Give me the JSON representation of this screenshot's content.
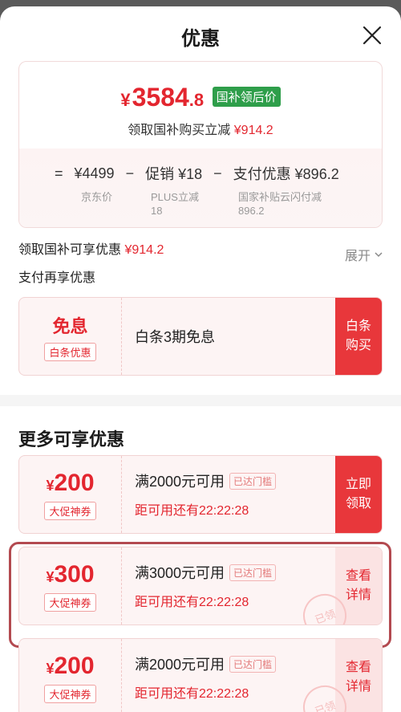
{
  "header": {
    "title": "优惠"
  },
  "price_card": {
    "currency": "¥",
    "price_int": "3584",
    "price_dec": ".8",
    "tag": "国补领后价",
    "sub_label": "领取国补购买立减",
    "sub_amount": "¥914.2",
    "calc": {
      "eq": "=",
      "jd_price": "¥4499",
      "minus1": "−",
      "promo": "促销 ¥18",
      "minus2": "−",
      "pay": "支付优惠 ¥896.2",
      "jd_price_label": "京东价",
      "promo_label_1": "PLUS立减",
      "promo_label_2": "18",
      "pay_label_1": "国家补贴云闪付减",
      "pay_label_2": "896.2"
    }
  },
  "subsidy_row": {
    "label": "领取国补可享优惠",
    "amount": "¥914.2",
    "expand": "展开"
  },
  "pay_more": {
    "title": "支付再享优惠"
  },
  "baitiao": {
    "title": "免息",
    "badge": "白条优惠",
    "desc": "白条3期免息",
    "action_1": "白条",
    "action_2": "购买"
  },
  "more_section": {
    "title": "更多可享优惠"
  },
  "coupons": [
    {
      "currency": "¥",
      "amount": "200",
      "badge": "大促神券",
      "condition": "满2000元可用",
      "reached": "已达门槛",
      "timer": "距可用还有22:22:28",
      "action_1": "立即",
      "action_2": "领取",
      "stamp": ""
    },
    {
      "currency": "¥",
      "amount": "300",
      "badge": "大促神券",
      "condition": "满3000元可用",
      "reached": "已达门槛",
      "timer": "距可用还有22:22:28",
      "action_1": "查看",
      "action_2": "详情",
      "stamp": "已领"
    },
    {
      "currency": "¥",
      "amount": "200",
      "badge": "大促神券",
      "condition": "满2000元可用",
      "reached": "已达门槛",
      "timer": "距可用还有22:22:28",
      "action_1": "查看",
      "action_2": "详情",
      "stamp": "已领"
    }
  ],
  "colors": {
    "accent": "#e3262f",
    "subsidy_tag": "#2e9e4a",
    "highlight_border": "#b34a50"
  }
}
